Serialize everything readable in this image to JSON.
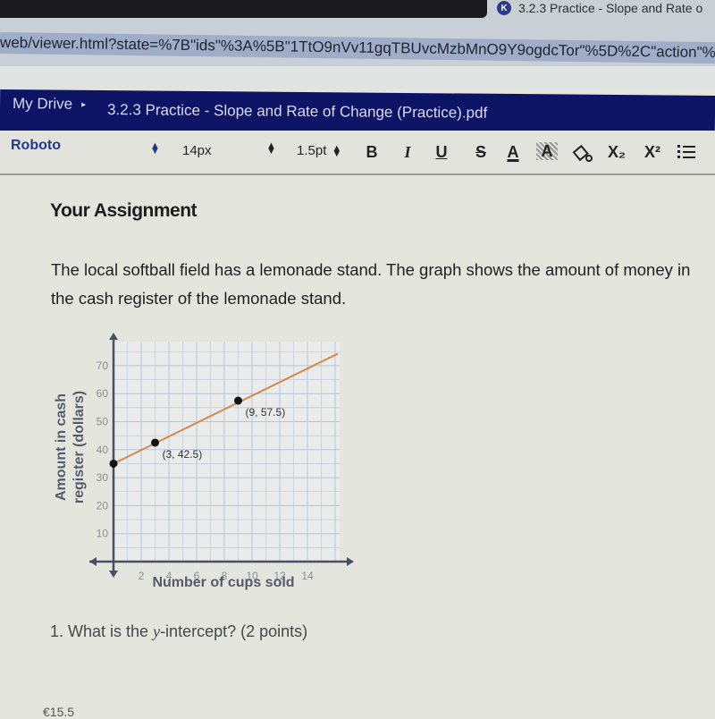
{
  "browser": {
    "tab_title": "3.2.3 Practice - Slope and Rate o",
    "tab_icon_letter": "K",
    "url": "web/viewer.html?state=%7B\"ids\"%3A%5B\"1TtO9nVv11gqTBUvcMzbMnO9Y9ogdcTor\"%5D%2C\"action\"%3"
  },
  "drive_bar": {
    "breadcrumb_root": "My Drive",
    "breadcrumb_separator": "▸",
    "file_name": "3.2.3 Practice - Slope and Rate of Change (Practice).pdf"
  },
  "toolbar": {
    "font_family": "Roboto",
    "font_size": "14px",
    "line_width": "1.5pt",
    "bold": "B",
    "italic": "I",
    "underline": "U",
    "strikethrough": "S",
    "text_color": "A",
    "highlight": "A",
    "fill_icon": "fill-bucket",
    "subscript": "X₂",
    "superscript": "X²",
    "list_icon": "numbered-list"
  },
  "document": {
    "heading": "Your Assignment",
    "paragraph": "The local softball field has a lemonade stand. The graph shows the amount of money in the cash register of the lemonade stand.",
    "question_prefix": "1. What is the ",
    "question_var": "y",
    "question_suffix": "-intercept? (2 points)",
    "cutoff_text": "€15.5"
  },
  "chart_data": {
    "type": "line",
    "title": "",
    "xlabel": "Number of cups sold",
    "ylabel": "Amount in cash register (dollars)",
    "ylabel_lines": [
      "Amount in cash",
      "register (dollars)"
    ],
    "xlim": [
      0,
      16
    ],
    "ylim": [
      0,
      75
    ],
    "x_ticks": [
      2,
      4,
      6,
      8,
      10,
      12,
      14
    ],
    "y_ticks": [
      10,
      20,
      30,
      40,
      50,
      60,
      70
    ],
    "grid": true,
    "line": {
      "x": [
        0,
        16.2
      ],
      "y": [
        35,
        74.3
      ],
      "slope": 2.5,
      "intercept": 35
    },
    "points": [
      {
        "x": 0,
        "y": 35,
        "label": ""
      },
      {
        "x": 3,
        "y": 42.5,
        "label": "(3, 42.5)"
      },
      {
        "x": 9,
        "y": 57.5,
        "label": "(9, 57.5)"
      }
    ],
    "colors": {
      "line": "#d9874a",
      "grid": "#b7c4d8",
      "axis": "#4a4e63",
      "point": "#111111"
    }
  }
}
